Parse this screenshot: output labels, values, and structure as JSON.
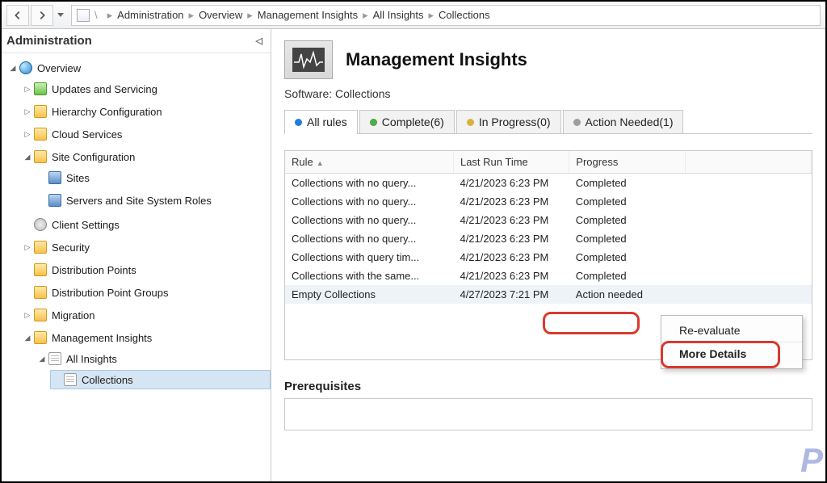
{
  "breadcrumb": [
    "Administration",
    "Overview",
    "Management Insights",
    "All Insights",
    "Collections"
  ],
  "left": {
    "title": "Administration",
    "nodes": {
      "overview": "Overview",
      "updates": "Updates and Servicing",
      "hierarchy": "Hierarchy Configuration",
      "cloud": "Cloud Services",
      "siteconfig": "Site Configuration",
      "sites": "Sites",
      "serversroles": "Servers and Site System Roles",
      "clientset": "Client Settings",
      "security": "Security",
      "distpoints": "Distribution Points",
      "distgroups": "Distribution Point Groups",
      "migration": "Migration",
      "mginsights": "Management Insights",
      "allinsights": "All Insights",
      "collections": "Collections"
    }
  },
  "header": {
    "title": "Management Insights"
  },
  "software_line": "Software: Collections",
  "tabs": {
    "all": "All rules",
    "complete": "Complete(6)",
    "inprogress": "In Progress(0)",
    "action": "Action Needed(1)"
  },
  "grid": {
    "cols": {
      "rule": "Rule",
      "time": "Last Run Time",
      "progress": "Progress"
    },
    "rows": [
      {
        "rule": "Collections with no query...",
        "time": "4/21/2023 6:23 PM",
        "progress": "Completed"
      },
      {
        "rule": "Collections with no query...",
        "time": "4/21/2023 6:23 PM",
        "progress": "Completed"
      },
      {
        "rule": "Collections with no query...",
        "time": "4/21/2023 6:23 PM",
        "progress": "Completed"
      },
      {
        "rule": "Collections with no query...",
        "time": "4/21/2023 6:23 PM",
        "progress": "Completed"
      },
      {
        "rule": "Collections with query tim...",
        "time": "4/21/2023 6:23 PM",
        "progress": "Completed"
      },
      {
        "rule": "Collections with the same...",
        "time": "4/21/2023 6:23 PM",
        "progress": "Completed"
      },
      {
        "rule": "Empty Collections",
        "time": "4/27/2023 7:21 PM",
        "progress": "Action needed"
      }
    ]
  },
  "context_menu": {
    "reeval": "Re-evaluate",
    "details": "More Details"
  },
  "prereq_heading": "Prerequisites"
}
